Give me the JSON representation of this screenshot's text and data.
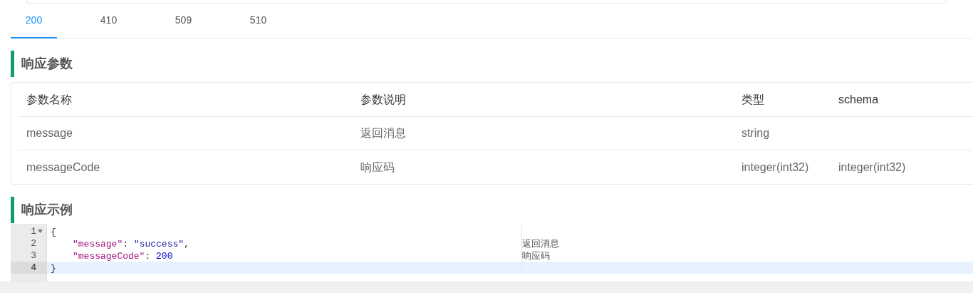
{
  "tabs": [
    {
      "label": "200",
      "selected": true
    },
    {
      "label": "410",
      "selected": false
    },
    {
      "label": "509",
      "selected": false
    },
    {
      "label": "510",
      "selected": false
    }
  ],
  "params_section": {
    "title": "响应参数"
  },
  "table": {
    "columns": [
      "参数名称",
      "参数说明",
      "类型",
      "schema"
    ],
    "rows": [
      [
        "message",
        "返回消息",
        "string",
        ""
      ],
      [
        "messageCode",
        "响应码",
        "integer(int32)",
        "integer(int32)"
      ]
    ]
  },
  "example_section": {
    "title": "响应示例"
  },
  "code": {
    "lines": [
      {
        "number": "1",
        "foldable": true,
        "active": false,
        "indented": false,
        "tokens": [
          {
            "kind": "punct",
            "text": "{"
          }
        ]
      },
      {
        "number": "2",
        "foldable": false,
        "active": false,
        "indented": true,
        "tokens": [
          {
            "kind": "key",
            "text": "\"message\""
          },
          {
            "kind": "punct",
            "text": ": "
          },
          {
            "kind": "string",
            "text": "\"success\""
          },
          {
            "kind": "punct",
            "text": ","
          }
        ],
        "comment": "返回消息"
      },
      {
        "number": "3",
        "foldable": false,
        "active": false,
        "indented": true,
        "tokens": [
          {
            "kind": "key",
            "text": "\"messageCode\""
          },
          {
            "kind": "punct",
            "text": ": "
          },
          {
            "kind": "number",
            "text": "200"
          }
        ],
        "comment": "响应码"
      },
      {
        "number": "4",
        "foldable": false,
        "active": true,
        "indented": false,
        "tokens": [
          {
            "kind": "punct",
            "text": "}"
          }
        ]
      }
    ]
  }
}
